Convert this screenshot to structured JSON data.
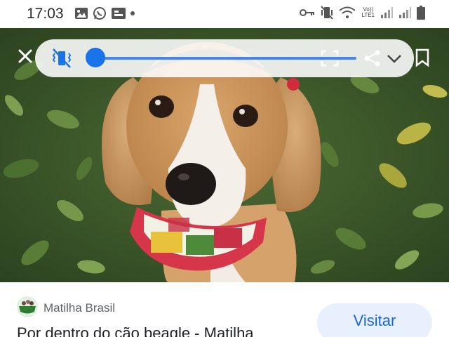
{
  "status_bar": {
    "time": "17:03",
    "left_icons": [
      "gallery-icon",
      "whatsapp-icon",
      "cast-icon",
      "notification-dot"
    ],
    "right_icons": [
      "key-icon",
      "vibrate-mute-icon",
      "wifi-icon",
      "volte-icon",
      "signal-icon",
      "signal-icon",
      "battery-icon"
    ],
    "volte_text_top": "Vo))",
    "volte_text_bottom": "LTE1"
  },
  "video_controls": {
    "close_icon": "close-icon",
    "mute_icon": "muted-vibrate-icon",
    "progress": 0.0,
    "expand_icon": "fullscreen-icon",
    "share_icon": "share-icon",
    "chevron_icon": "chevron-down-icon",
    "bookmark_icon": "bookmark-icon",
    "accent_color": "#1a73e8"
  },
  "card": {
    "source_name": "Matilha Brasil",
    "page_title": "Por dentro do cão beagle - Matilha",
    "visit_label": "Visitar",
    "visit_color": "#1967d2"
  }
}
